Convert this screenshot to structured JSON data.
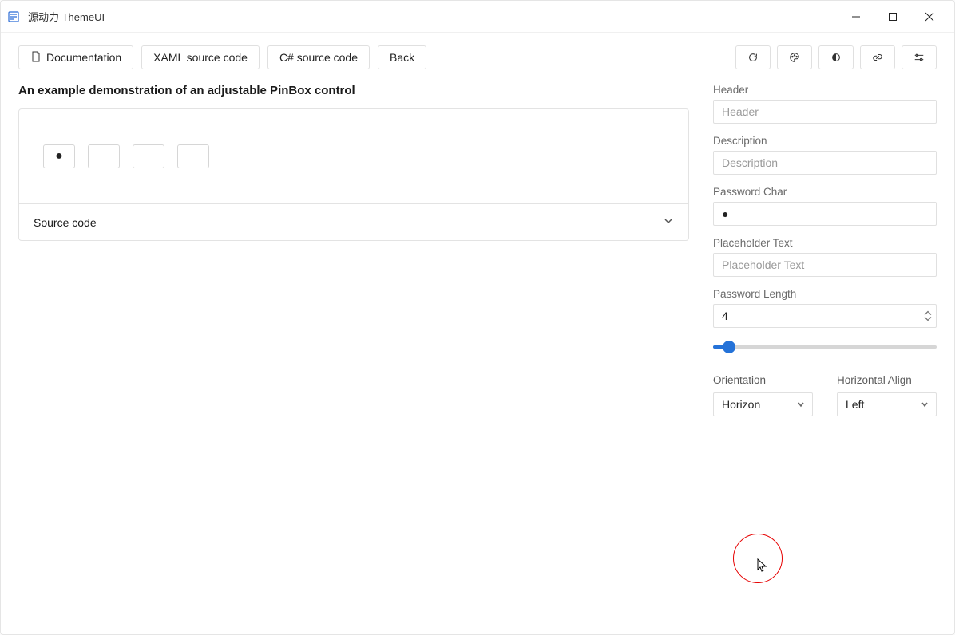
{
  "titlebar": {
    "title": "源动力 ThemeUI"
  },
  "toolbar": {
    "documentation": "Documentation",
    "xaml": "XAML source code",
    "csharp": "C# source code",
    "back": "Back"
  },
  "example": {
    "heading": "An example demonstration of an adjustable PinBox control",
    "pin_values": [
      "●",
      "",
      "",
      ""
    ],
    "source_code_label": "Source code"
  },
  "panel": {
    "header_label": "Header",
    "header_placeholder": "Header",
    "description_label": "Description",
    "description_placeholder": "Description",
    "password_char_label": "Password Char",
    "password_char_value": "●",
    "placeholder_text_label": "Placeholder Text",
    "placeholder_text_placeholder": "Placeholder Text",
    "password_length_label": "Password Length",
    "password_length_value": "4",
    "orientation_label": "Orientation",
    "orientation_value": "Horizon",
    "horizontal_align_label": "Horizontal Align",
    "horizontal_align_value": "Left"
  }
}
